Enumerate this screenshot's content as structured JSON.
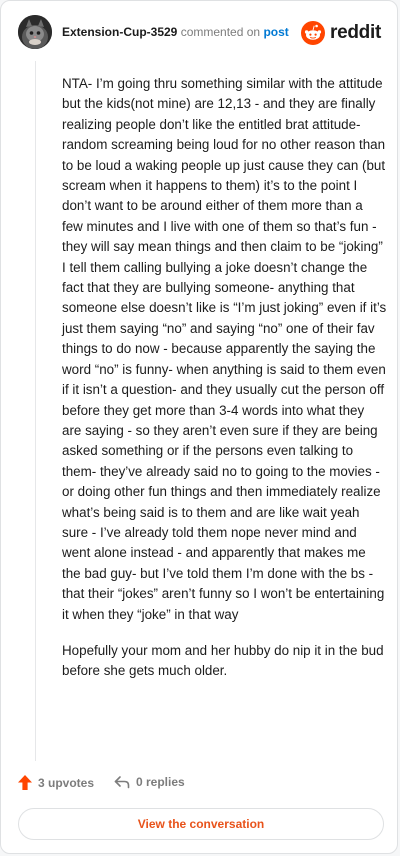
{
  "comment": {
    "username": "Extension-Cup-3529",
    "commented_text": "commented on",
    "post_link": "post",
    "paragraphs": [
      "NTA- I’m going thru something similar with the attitude but the kids(not mine) are 12,13 - and they are finally realizing people don’t like the entitled brat attitude- random screaming being loud for no other reason than to be loud a waking people up just cause they can (but scream when it happens to them) it’s to the point I don’t want to be around either of them more than a few minutes and I live with one of them so that’s fun - they will say mean things and then claim to be “joking” I tell them calling bullying a joke doesn’t change the fact that they are bullying someone- anything that someone else doesn’t like is “I’m just joking” even if it’s just them saying “no” and saying “no” one of their fav things to do now - because apparently the saying the word “no” is funny- when anything is said to them even if it isn’t a question- and they usually cut the person off before they get more than 3-4 words into what they are saying - so they aren’t even sure if they are being asked something or if the persons even talking to them- they’ve already said no to going to the movies - or doing other fun things and then immediately realize what’s being said is to them and are like wait yeah sure - I’ve already told them nope never mind and went alone instead - and apparently that makes me the bad guy- but I’ve told them I’m done with the bs - that their “jokes” aren’t funny so I won’t be entertaining it when they “joke” in that way",
      "Hopefully your mom and her hubby do nip it in the bud before she gets much older."
    ],
    "upvotes": "3 upvotes",
    "replies": "0 replies"
  },
  "brand": {
    "logo_text": "reddit",
    "accent": "#ff4500"
  },
  "actions": {
    "view_conversation": "View the conversation"
  },
  "icons": {
    "upvote": "upvote-arrow-icon",
    "reply": "reply-arrow-icon",
    "logo": "reddit-snoo-icon"
  }
}
